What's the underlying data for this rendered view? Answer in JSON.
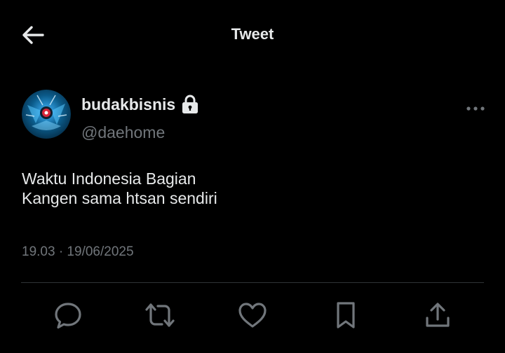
{
  "header": {
    "title": "Tweet",
    "back_icon": "arrow-left-icon"
  },
  "author": {
    "display_name": "budakbisnis",
    "handle": "@daehome",
    "protected": true,
    "lock_icon": "lock-icon",
    "avatar_icon": "avatar-image"
  },
  "tweet": {
    "lines": [
      "Waktu Indonesia Bagian",
      "Kangen sama htsan sendiri"
    ],
    "timestamp": "19.03 · 19/06/2025"
  },
  "more_icon": "more-horizontal-icon",
  "actions": [
    {
      "name": "reply",
      "icon": "reply-icon"
    },
    {
      "name": "retweet",
      "icon": "retweet-icon"
    },
    {
      "name": "like",
      "icon": "heart-icon"
    },
    {
      "name": "bookmark",
      "icon": "bookmark-icon"
    },
    {
      "name": "share",
      "icon": "share-icon"
    }
  ],
  "colors": {
    "background": "#000000",
    "primary_text": "#e7e9ea",
    "secondary_text": "#71767b",
    "divider": "#2f3336",
    "avatar_base": "#0b5b8a"
  }
}
